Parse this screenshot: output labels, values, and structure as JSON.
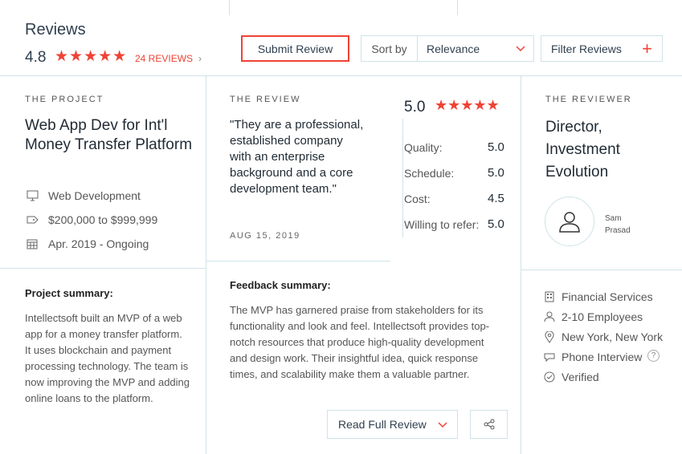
{
  "header": {
    "title": "Reviews",
    "rating": "4.8",
    "stars": "★★★★★",
    "reviews_link": "24 REVIEWS",
    "chevron": "›",
    "submit_label": "Submit Review",
    "sort_label": "Sort by",
    "sort_value": "Relevance",
    "filter_label": "Filter Reviews",
    "filter_plus": "+"
  },
  "project": {
    "caption": "THE PROJECT",
    "title": "Web App Dev for Int'l Money Transfer Platform",
    "service": "Web Development",
    "budget": "$200,000 to $999,999",
    "dates": "Apr. 2019 - Ongoing",
    "summary_heading": "Project summary:",
    "summary_text": "Intellectsoft built an MVP of a web app for a money transfer platform. It uses blockchain and payment processing technology. The team is now improving the MVP and adding online loans to the platform."
  },
  "review": {
    "caption": "THE REVIEW",
    "quote": "\"They are a professional, established company with an enterprise background and a core development team.\"",
    "date": "AUG 15, 2019",
    "overall": "5.0",
    "stars": "★★★★★",
    "scores": [
      {
        "label": "Quality:",
        "value": "5.0"
      },
      {
        "label": "Schedule:",
        "value": "5.0"
      },
      {
        "label": "Cost:",
        "value": "4.5"
      },
      {
        "label": "Willing to refer:",
        "value": "5.0"
      }
    ],
    "feedback_heading": "Feedback summary:",
    "feedback_text": "The MVP has garnered praise from stakeholders for its functionality and look and feel. Intellectsoft provides top-notch resources that produce high-quality development and design work. Their insightful idea, quick response times, and scalability make them a valuable partner.",
    "read_full_label": "Read Full Review"
  },
  "reviewer": {
    "caption": "THE REVIEWER",
    "title": "Director, Investment Evolution",
    "name": "Sam Prasad",
    "industry": "Financial Services",
    "employees": "2-10 Employees",
    "location": "New York, New York",
    "interview": "Phone Interview",
    "help": "?",
    "verified": "Verified"
  },
  "colors": {
    "accent": "#ef4335",
    "border": "#cfe3e8",
    "text": "#30404f"
  }
}
